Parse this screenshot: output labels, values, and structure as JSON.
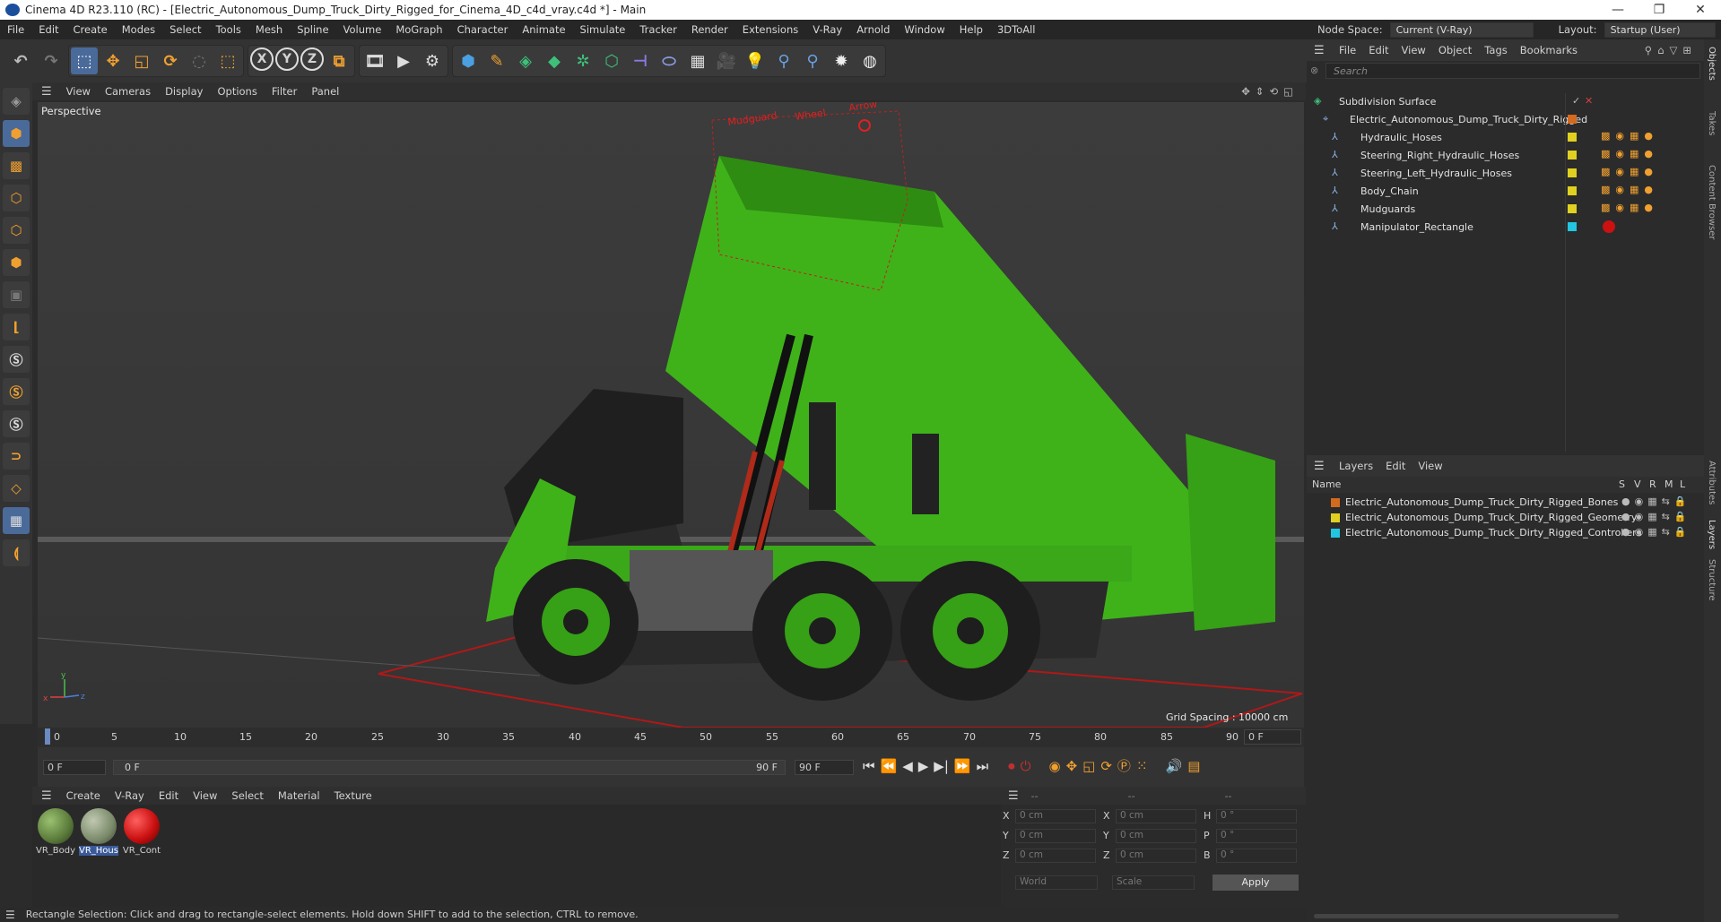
{
  "window": {
    "title": "Cinema 4D R23.110 (RC) - [Electric_Autonomous_Dump_Truck_Dirty_Rigged_for_Cinema_4D_c4d_vray.c4d *] - Main",
    "minimize": "—",
    "maximize": "❐",
    "close": "✕"
  },
  "menubar": {
    "items": [
      "File",
      "Edit",
      "Create",
      "Modes",
      "Select",
      "Tools",
      "Mesh",
      "Spline",
      "Volume",
      "MoGraph",
      "Character",
      "Animate",
      "Simulate",
      "Tracker",
      "Render",
      "Extensions",
      "V-Ray",
      "Arnold",
      "Window",
      "Help",
      "3DToAll"
    ]
  },
  "nodespace": {
    "label": "Node Space:",
    "value": "Current (V-Ray)",
    "layout_label": "Layout:",
    "layout_value": "Startup (User)"
  },
  "toolbar": {
    "axis_x": "X",
    "axis_y": "Y",
    "axis_z": "Z"
  },
  "viewport": {
    "menu": [
      "View",
      "Cameras",
      "Display",
      "Options",
      "Filter",
      "Panel"
    ],
    "label": "Perspective",
    "grid_spacing": "Grid Spacing : 10000 cm",
    "axis_x": "x",
    "axis_y": "y",
    "axis_z": "z",
    "annotations": [
      "Mudguard",
      "Wheel",
      "Arrow"
    ]
  },
  "timeline": {
    "ticks": [
      "0",
      "5",
      "10",
      "15",
      "20",
      "25",
      "30",
      "35",
      "40",
      "45",
      "50",
      "55",
      "60",
      "65",
      "70",
      "75",
      "80",
      "85",
      "90"
    ],
    "current_frame_right": "0 F",
    "start_field": "0 F",
    "range_start": "0 F",
    "range_end": "90 F",
    "end_field": "90 F"
  },
  "materials": {
    "menu": [
      "Create",
      "V-Ray",
      "Edit",
      "View",
      "Select",
      "Material",
      "Texture"
    ],
    "items": [
      {
        "label": "VR_Body",
        "color": "#5a7a3a"
      },
      {
        "label": "VR_Hous",
        "color": "#7a8a6a"
      },
      {
        "label": "VR_Cont",
        "color": "#cc1111"
      }
    ]
  },
  "coords": {
    "header": [
      "--",
      "--",
      "--"
    ],
    "labels_pos": [
      "X",
      "Y",
      "Z"
    ],
    "labels_size": [
      "X",
      "Y",
      "Z"
    ],
    "labels_rot": [
      "H",
      "P",
      "B"
    ],
    "pos_values": [
      "0 cm",
      "0 cm",
      "0 cm"
    ],
    "size_values": [
      "0 cm",
      "0 cm",
      "0 cm"
    ],
    "rot_values": [
      "0 °",
      "0 °",
      "0 °"
    ],
    "mode": "World",
    "scale": "Scale",
    "apply": "Apply"
  },
  "status": {
    "text": "Rectangle Selection: Click and drag to rectangle-select elements. Hold down SHIFT to add to the selection, CTRL to remove."
  },
  "objects": {
    "menu": [
      "File",
      "Edit",
      "View",
      "Object",
      "Tags",
      "Bookmarks"
    ],
    "search_placeholder": "Search",
    "items": [
      {
        "name": "Subdivision Surface",
        "color": "#888888"
      },
      {
        "name": "Electric_Autonomous_Dump_Truck_Dirty_Rigged",
        "color": "#d46a1e"
      },
      {
        "name": "Hydraulic_Hoses",
        "color": "#e0d020"
      },
      {
        "name": "Steering_Right_Hydraulic_Hoses",
        "color": "#e0d020"
      },
      {
        "name": "Steering_Left_Hydraulic_Hoses",
        "color": "#e0d020"
      },
      {
        "name": "Body_Chain",
        "color": "#e0d020"
      },
      {
        "name": "Mudguards",
        "color": "#e0d020"
      },
      {
        "name": "Manipulator_Rectangle",
        "color": "#22c6e0"
      }
    ]
  },
  "layers": {
    "menu": [
      "Layers",
      "Edit",
      "View"
    ],
    "columns": [
      "Name",
      "S",
      "V",
      "R",
      "M",
      "L"
    ],
    "items": [
      {
        "name": "Electric_Autonomous_Dump_Truck_Dirty_Rigged_Bones",
        "color": "#d46a1e"
      },
      {
        "name": "Electric_Autonomous_Dump_Truck_Dirty_Rigged_Geometry",
        "color": "#e0d020"
      },
      {
        "name": "Electric_Autonomous_Dump_Truck_Dirty_Rigged_Controllers",
        "color": "#22c6e0"
      }
    ]
  },
  "sidetabs": [
    "Objects",
    "Takes",
    "Content Browser",
    "Attributes",
    "Layers",
    "Structure"
  ]
}
